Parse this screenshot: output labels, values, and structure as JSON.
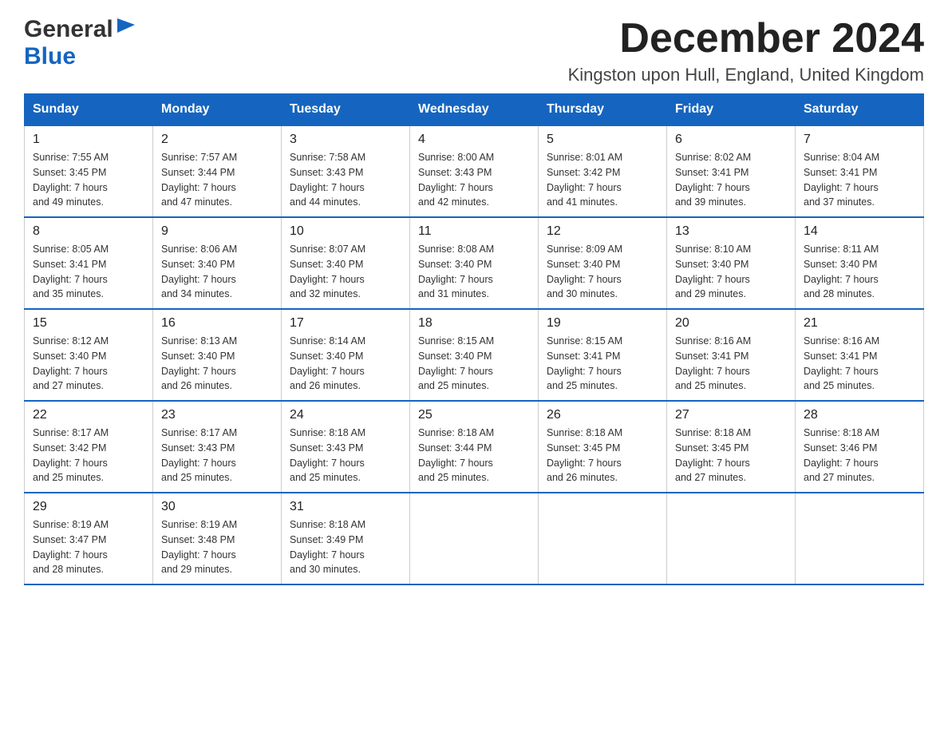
{
  "logo": {
    "general": "General",
    "blue": "Blue"
  },
  "header": {
    "month_year": "December 2024",
    "location": "Kingston upon Hull, England, United Kingdom"
  },
  "weekdays": [
    "Sunday",
    "Monday",
    "Tuesday",
    "Wednesday",
    "Thursday",
    "Friday",
    "Saturday"
  ],
  "weeks": [
    [
      {
        "day": "1",
        "sunrise": "7:55 AM",
        "sunset": "3:45 PM",
        "daylight": "7 hours and 49 minutes."
      },
      {
        "day": "2",
        "sunrise": "7:57 AM",
        "sunset": "3:44 PM",
        "daylight": "7 hours and 47 minutes."
      },
      {
        "day": "3",
        "sunrise": "7:58 AM",
        "sunset": "3:43 PM",
        "daylight": "7 hours and 44 minutes."
      },
      {
        "day": "4",
        "sunrise": "8:00 AM",
        "sunset": "3:43 PM",
        "daylight": "7 hours and 42 minutes."
      },
      {
        "day": "5",
        "sunrise": "8:01 AM",
        "sunset": "3:42 PM",
        "daylight": "7 hours and 41 minutes."
      },
      {
        "day": "6",
        "sunrise": "8:02 AM",
        "sunset": "3:41 PM",
        "daylight": "7 hours and 39 minutes."
      },
      {
        "day": "7",
        "sunrise": "8:04 AM",
        "sunset": "3:41 PM",
        "daylight": "7 hours and 37 minutes."
      }
    ],
    [
      {
        "day": "8",
        "sunrise": "8:05 AM",
        "sunset": "3:41 PM",
        "daylight": "7 hours and 35 minutes."
      },
      {
        "day": "9",
        "sunrise": "8:06 AM",
        "sunset": "3:40 PM",
        "daylight": "7 hours and 34 minutes."
      },
      {
        "day": "10",
        "sunrise": "8:07 AM",
        "sunset": "3:40 PM",
        "daylight": "7 hours and 32 minutes."
      },
      {
        "day": "11",
        "sunrise": "8:08 AM",
        "sunset": "3:40 PM",
        "daylight": "7 hours and 31 minutes."
      },
      {
        "day": "12",
        "sunrise": "8:09 AM",
        "sunset": "3:40 PM",
        "daylight": "7 hours and 30 minutes."
      },
      {
        "day": "13",
        "sunrise": "8:10 AM",
        "sunset": "3:40 PM",
        "daylight": "7 hours and 29 minutes."
      },
      {
        "day": "14",
        "sunrise": "8:11 AM",
        "sunset": "3:40 PM",
        "daylight": "7 hours and 28 minutes."
      }
    ],
    [
      {
        "day": "15",
        "sunrise": "8:12 AM",
        "sunset": "3:40 PM",
        "daylight": "7 hours and 27 minutes."
      },
      {
        "day": "16",
        "sunrise": "8:13 AM",
        "sunset": "3:40 PM",
        "daylight": "7 hours and 26 minutes."
      },
      {
        "day": "17",
        "sunrise": "8:14 AM",
        "sunset": "3:40 PM",
        "daylight": "7 hours and 26 minutes."
      },
      {
        "day": "18",
        "sunrise": "8:15 AM",
        "sunset": "3:40 PM",
        "daylight": "7 hours and 25 minutes."
      },
      {
        "day": "19",
        "sunrise": "8:15 AM",
        "sunset": "3:41 PM",
        "daylight": "7 hours and 25 minutes."
      },
      {
        "day": "20",
        "sunrise": "8:16 AM",
        "sunset": "3:41 PM",
        "daylight": "7 hours and 25 minutes."
      },
      {
        "day": "21",
        "sunrise": "8:16 AM",
        "sunset": "3:41 PM",
        "daylight": "7 hours and 25 minutes."
      }
    ],
    [
      {
        "day": "22",
        "sunrise": "8:17 AM",
        "sunset": "3:42 PM",
        "daylight": "7 hours and 25 minutes."
      },
      {
        "day": "23",
        "sunrise": "8:17 AM",
        "sunset": "3:43 PM",
        "daylight": "7 hours and 25 minutes."
      },
      {
        "day": "24",
        "sunrise": "8:18 AM",
        "sunset": "3:43 PM",
        "daylight": "7 hours and 25 minutes."
      },
      {
        "day": "25",
        "sunrise": "8:18 AM",
        "sunset": "3:44 PM",
        "daylight": "7 hours and 25 minutes."
      },
      {
        "day": "26",
        "sunrise": "8:18 AM",
        "sunset": "3:45 PM",
        "daylight": "7 hours and 26 minutes."
      },
      {
        "day": "27",
        "sunrise": "8:18 AM",
        "sunset": "3:45 PM",
        "daylight": "7 hours and 27 minutes."
      },
      {
        "day": "28",
        "sunrise": "8:18 AM",
        "sunset": "3:46 PM",
        "daylight": "7 hours and 27 minutes."
      }
    ],
    [
      {
        "day": "29",
        "sunrise": "8:19 AM",
        "sunset": "3:47 PM",
        "daylight": "7 hours and 28 minutes."
      },
      {
        "day": "30",
        "sunrise": "8:19 AM",
        "sunset": "3:48 PM",
        "daylight": "7 hours and 29 minutes."
      },
      {
        "day": "31",
        "sunrise": "8:18 AM",
        "sunset": "3:49 PM",
        "daylight": "7 hours and 30 minutes."
      },
      null,
      null,
      null,
      null
    ]
  ],
  "labels": {
    "sunrise": "Sunrise:",
    "sunset": "Sunset:",
    "daylight": "Daylight:"
  }
}
